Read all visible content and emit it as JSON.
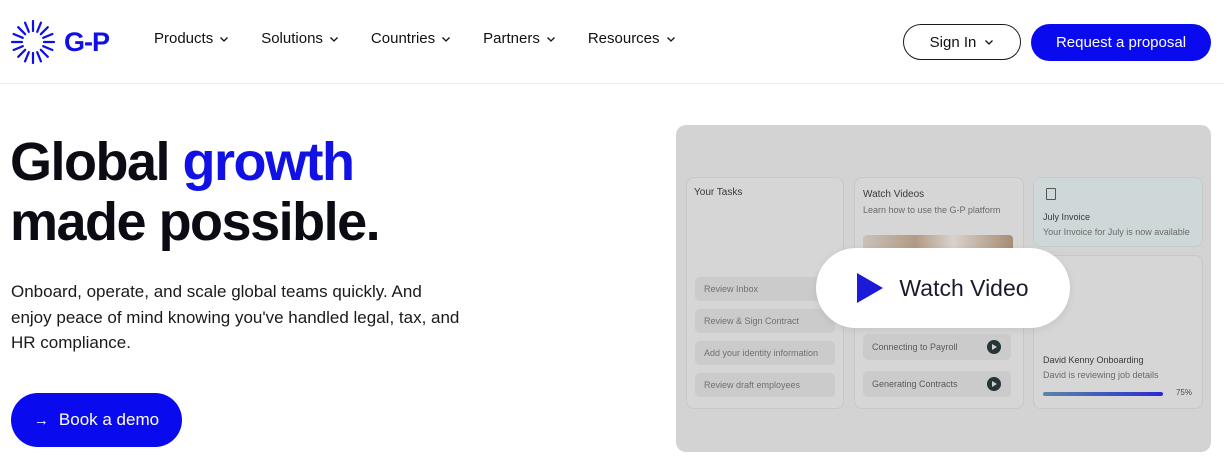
{
  "brand": {
    "logo_text": "G-P",
    "accent_color": "#0a0aef"
  },
  "nav": {
    "items": [
      {
        "label": "Products"
      },
      {
        "label": "Solutions"
      },
      {
        "label": "Countries"
      },
      {
        "label": "Partners"
      },
      {
        "label": "Resources"
      }
    ],
    "sign_in": "Sign In",
    "request_proposal": "Request a proposal"
  },
  "hero": {
    "title_part1": "Global ",
    "title_accent": "growth",
    "title_line2": "made possible.",
    "subtitle": "Onboard, operate, and scale global teams quickly. And enjoy peace of mind knowing you've handled legal, tax, and HR compliance.",
    "cta_label": "Book a demo"
  },
  "video": {
    "button_label": "Watch Video",
    "tasks": {
      "title": "Your Tasks",
      "items": [
        "Review Inbox",
        "Review & Sign Contract",
        "Add your identity information",
        "Review draft employees"
      ]
    },
    "watch_videos": {
      "title": "Watch Videos",
      "subtitle": "Learn how to use the G-P platform",
      "items": [
        "Connecting to Payroll",
        "Generating Contracts"
      ]
    },
    "invoice": {
      "title": "July Invoice",
      "subtitle": "Your Invoice for July is now available"
    },
    "onboarding": {
      "title": "David Kenny Onboarding",
      "subtitle": "David is reviewing job details",
      "progress_label": "75%",
      "progress": 0.75
    }
  }
}
